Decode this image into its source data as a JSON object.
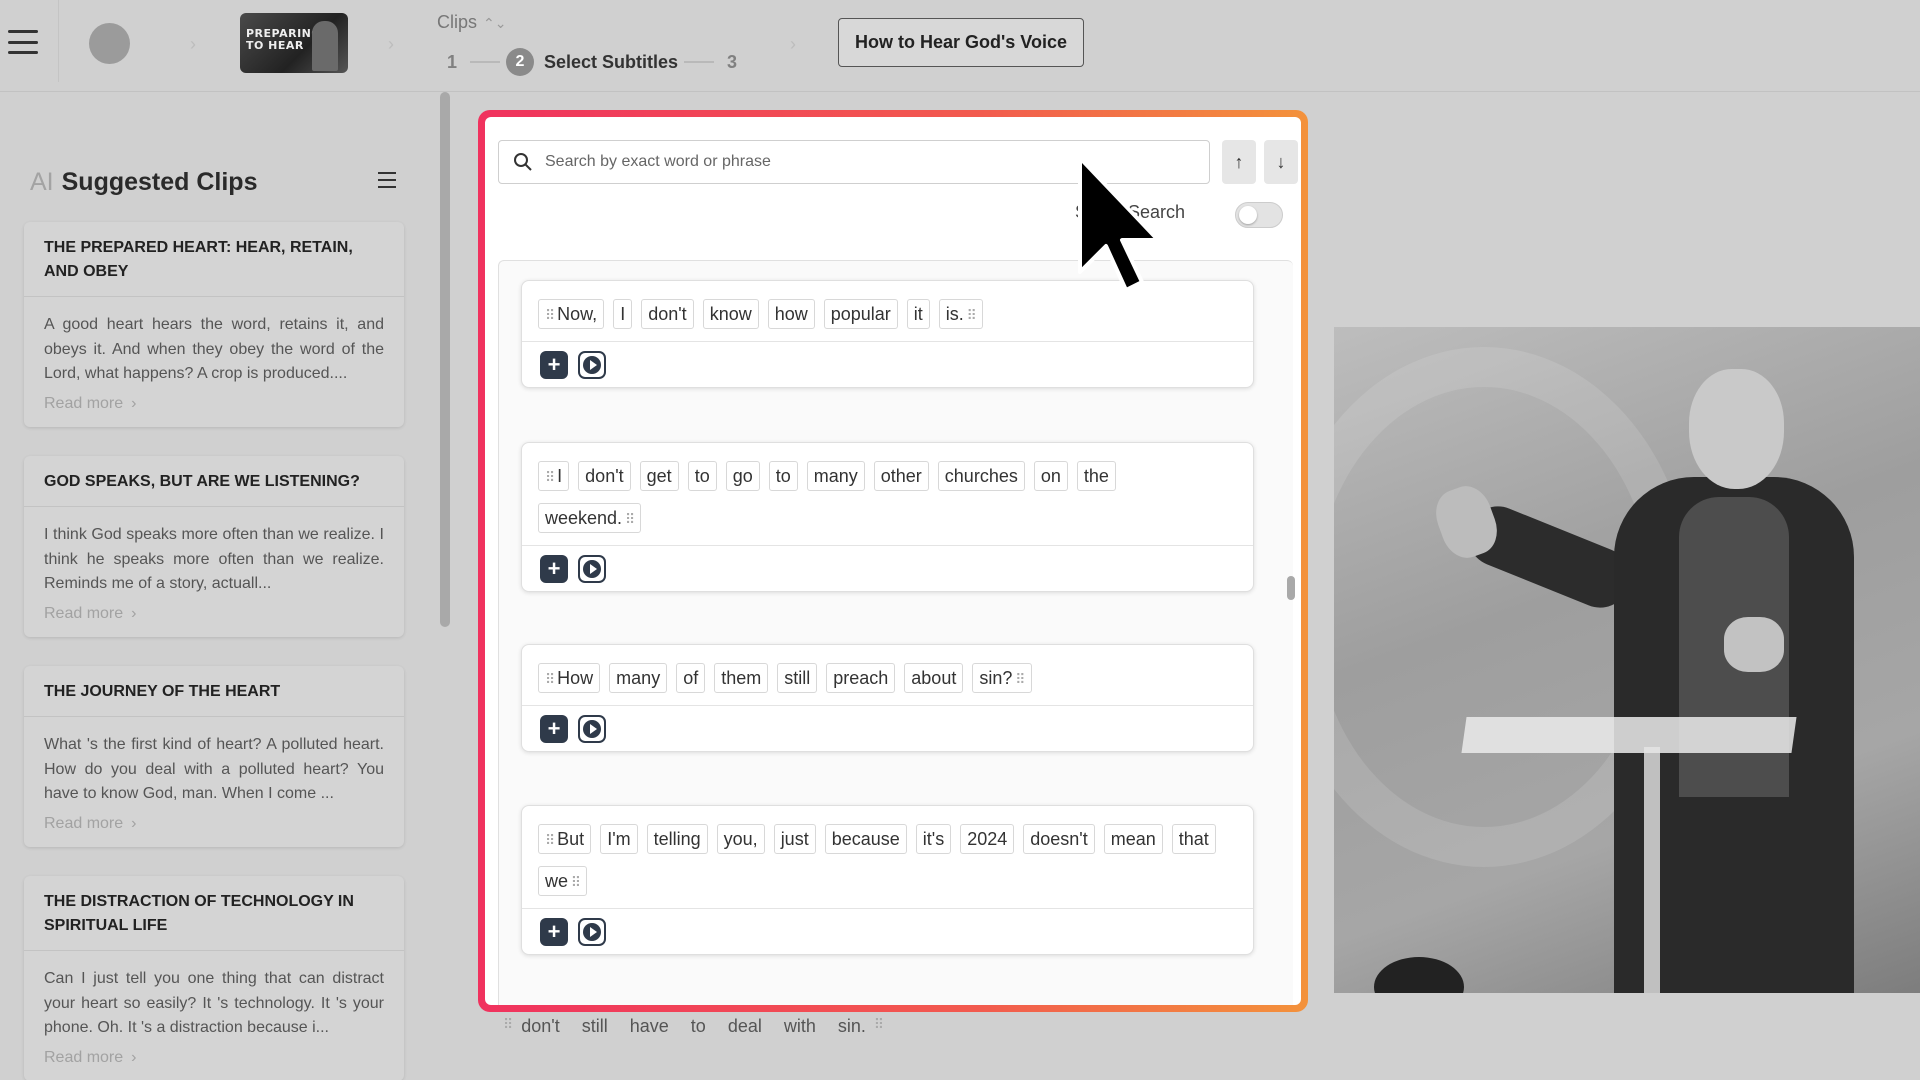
{
  "header": {
    "clips_label": "Clips",
    "steps": [
      {
        "num": "1"
      },
      {
        "num": "2",
        "label": "Select Subtitles"
      },
      {
        "num": "3"
      }
    ],
    "thumbnail_text_line1": "PREPARING",
    "thumbnail_text_line2": "TO HEAR",
    "title_button": "How to Hear God's Voice"
  },
  "sidebar": {
    "ai_label": "AI",
    "heading": "Suggested Clips",
    "read_more": "Read more",
    "cards": [
      {
        "title": "THE PREPARED HEART: HEAR, RETAIN, AND OBEY",
        "text": "A good heart hears the word, retains it, and obeys it. And when they obey the word of the Lord, what happens? A crop is produced...."
      },
      {
        "title": "GOD SPEAKS, BUT ARE WE LISTENING?",
        "text": "I think God speaks more often than we realize. I think he speaks more often than we realize. Reminds me of a story, actuall..."
      },
      {
        "title": "THE JOURNEY OF THE HEART",
        "text": "What 's the first kind of heart? A polluted heart. How do you deal with a polluted heart? You have to know God, man. When I come ..."
      },
      {
        "title": "THE DISTRACTION OF TECHNOLOGY IN SPIRITUAL LIFE",
        "text": "Can I just tell you one thing that can distract your heart so easily? It 's technology. It 's your phone. Oh. It 's a distraction because i..."
      }
    ]
  },
  "search": {
    "placeholder": "Search by exact word or phrase",
    "smart_search_label": "Smart Search"
  },
  "segments": [
    {
      "words": [
        "Now,",
        "I",
        "don't",
        "know",
        "how",
        "popular",
        "it",
        "is."
      ]
    },
    {
      "words": [
        "I",
        "don't",
        "get",
        "to",
        "go",
        "to",
        "many",
        "other",
        "churches",
        "on",
        "the",
        "weekend."
      ]
    },
    {
      "words": [
        "How",
        "many",
        "of",
        "them",
        "still",
        "preach",
        "about",
        "sin?"
      ]
    },
    {
      "words": [
        "But",
        "I'm",
        "telling",
        "you,",
        "just",
        "because",
        "it's",
        "2024",
        "doesn't",
        "mean",
        "that",
        "we"
      ]
    }
  ],
  "below_segment_words": [
    "don't",
    "still",
    "have",
    "to",
    "deal",
    "with",
    "sin."
  ]
}
